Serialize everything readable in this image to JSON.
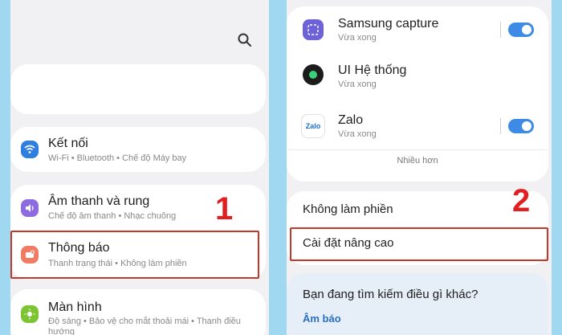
{
  "left": {
    "step_number": "1",
    "items": [
      {
        "title": "Kết nối",
        "subtitle": "Wi-Fi • Bluetooth • Chế độ Máy bay"
      },
      {
        "title": "Âm thanh và rung",
        "subtitle": "Chế độ âm thanh • Nhạc chuông"
      },
      {
        "title": "Thông báo",
        "subtitle": "Thanh trạng thái • Không làm phiền"
      },
      {
        "title": "Màn hình",
        "subtitle": "Độ sáng • Bảo vệ cho mắt thoải mái • Thanh điều",
        "subtitle2": "hướng"
      }
    ]
  },
  "right": {
    "step_number": "2",
    "apps": [
      {
        "name": "Samsung capture",
        "time": "Vừa xong",
        "toggle_on": true
      },
      {
        "name": "UI Hệ thống",
        "time": "Vừa xong",
        "toggle_on": false
      },
      {
        "name": "Zalo",
        "time": "Vừa xong",
        "toggle_on": true,
        "icon_text": "Zalo"
      }
    ],
    "more_label": "Nhiều hơn",
    "menu": [
      {
        "label": "Không làm phiền"
      },
      {
        "label": "Cài đặt nâng cao"
      }
    ],
    "suggest": {
      "title": "Bạn đang tìm kiếm điều gì khác?",
      "link": "Âm báo"
    }
  },
  "colors": {
    "accent_red": "#e02020",
    "toggle_blue": "#3e8be6",
    "link_blue": "#2a6fc0"
  }
}
